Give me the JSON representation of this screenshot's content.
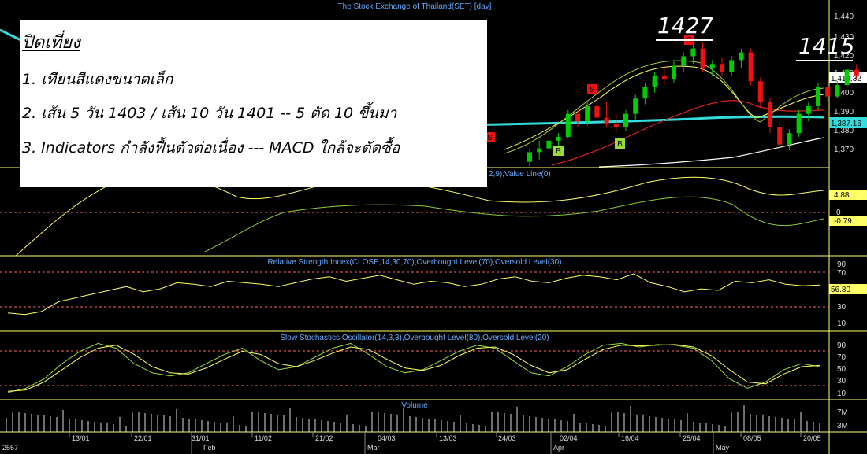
{
  "main_title": "The Stock Exchange of Thailand(SET) [day]",
  "macd_title": "2,9),Value Line(0)",
  "rsi_title": "Relative Strength Index(CLOSE,14,30,70),Overbought Level(70),Oversold Level(30)",
  "stoch_title": "Slow Stochastics Oscillator(14,3,3),Overbought Level(80),Oversold Level(20)",
  "volume_title": "Volume",
  "note": {
    "title": "ปิดเที่ยง",
    "lines": [
      "1. เทียนสีแดงขนาดเล็ก",
      "2. เส้น 5 วัน 1403 / เส้น 10 วัน 1401 -- 5 ตัด 10 ขึ้นมา",
      "3. Indicators กำลังฟื้นตัวต่อเนื่อง --- MACD ใกล้จะตัดซื้อ"
    ]
  },
  "annotations": {
    "high1": "1427",
    "high2": "1415"
  },
  "price_axis": [
    "1,440",
    "1,430",
    "1,420",
    "1,410",
    "1,400",
    "1,390",
    "1,380",
    "1,370"
  ],
  "price_tags": {
    "last": "1,410.32",
    "ma": "1,387.16"
  },
  "macd_axis": {
    "zero": "0",
    "val1": "4.88",
    "val2": "-0.79"
  },
  "rsi_axis": [
    "90",
    "70",
    "50",
    "30",
    "10"
  ],
  "rsi_tag": "56.80",
  "stoch_axis": [
    "90",
    "70",
    "50",
    "30",
    "10"
  ],
  "volume_axis": [
    "7M",
    "3M"
  ],
  "x_dates": [
    "13/01",
    "22/01",
    "31/01",
    "11/02",
    "21/02",
    "04/03",
    "13/03",
    "24/03",
    "02/04",
    "16/04",
    "25/04",
    "08/05",
    "20/05"
  ],
  "x_months": [
    "2557",
    "Feb",
    "Mar",
    "Apr",
    "May"
  ],
  "signals": [
    "S",
    "S",
    "S",
    "B",
    "B"
  ],
  "colors": {
    "bull": "#00cc00",
    "bear": "#ee1111",
    "ma_long": "#33dddd",
    "panel_line": "#ffff66",
    "grid": "#ff6666",
    "axis_text": "#dddddd",
    "title_text": "#66aaff"
  },
  "chart_data": [
    {
      "type": "candlestick",
      "title": "The Stock Exchange of Thailand(SET) [day]",
      "visible_candles": [
        {
          "o": 1365,
          "h": 1372,
          "l": 1362,
          "c": 1370
        },
        {
          "o": 1370,
          "h": 1376,
          "l": 1366,
          "c": 1372
        },
        {
          "o": 1372,
          "h": 1378,
          "l": 1369,
          "c": 1376
        },
        {
          "o": 1376,
          "h": 1380,
          "l": 1373,
          "c": 1378
        },
        {
          "o": 1378,
          "h": 1392,
          "l": 1377,
          "c": 1390
        },
        {
          "o": 1390,
          "h": 1392,
          "l": 1383,
          "c": 1386
        },
        {
          "o": 1386,
          "h": 1396,
          "l": 1384,
          "c": 1394
        },
        {
          "o": 1394,
          "h": 1398,
          "l": 1386,
          "c": 1388
        },
        {
          "o": 1388,
          "h": 1396,
          "l": 1383,
          "c": 1385
        },
        {
          "o": 1385,
          "h": 1390,
          "l": 1380,
          "c": 1383
        },
        {
          "o": 1383,
          "h": 1392,
          "l": 1381,
          "c": 1390
        },
        {
          "o": 1390,
          "h": 1400,
          "l": 1387,
          "c": 1398
        },
        {
          "o": 1398,
          "h": 1406,
          "l": 1395,
          "c": 1404
        },
        {
          "o": 1404,
          "h": 1412,
          "l": 1401,
          "c": 1410
        },
        {
          "o": 1410,
          "h": 1415,
          "l": 1405,
          "c": 1408
        },
        {
          "o": 1408,
          "h": 1418,
          "l": 1406,
          "c": 1415
        },
        {
          "o": 1415,
          "h": 1422,
          "l": 1412,
          "c": 1420
        },
        {
          "o": 1420,
          "h": 1426,
          "l": 1416,
          "c": 1424
        },
        {
          "o": 1424,
          "h": 1427,
          "l": 1412,
          "c": 1414
        },
        {
          "o": 1414,
          "h": 1418,
          "l": 1410,
          "c": 1416
        },
        {
          "o": 1416,
          "h": 1419,
          "l": 1410,
          "c": 1412
        },
        {
          "o": 1412,
          "h": 1420,
          "l": 1410,
          "c": 1418
        },
        {
          "o": 1418,
          "h": 1424,
          "l": 1414,
          "c": 1422
        },
        {
          "o": 1422,
          "h": 1424,
          "l": 1405,
          "c": 1407
        },
        {
          "o": 1407,
          "h": 1409,
          "l": 1393,
          "c": 1396
        },
        {
          "o": 1396,
          "h": 1398,
          "l": 1380,
          "c": 1383
        },
        {
          "o": 1383,
          "h": 1386,
          "l": 1370,
          "c": 1374
        },
        {
          "o": 1374,
          "h": 1382,
          "l": 1371,
          "c": 1380
        },
        {
          "o": 1380,
          "h": 1392,
          "l": 1378,
          "c": 1390
        },
        {
          "o": 1390,
          "h": 1396,
          "l": 1386,
          "c": 1394
        },
        {
          "o": 1394,
          "h": 1406,
          "l": 1392,
          "c": 1404
        },
        {
          "o": 1404,
          "h": 1408,
          "l": 1396,
          "c": 1399
        },
        {
          "o": 1399,
          "h": 1407,
          "l": 1398,
          "c": 1405
        },
        {
          "o": 1405,
          "h": 1415,
          "l": 1403,
          "c": 1413
        },
        {
          "o": 1413,
          "h": 1416,
          "l": 1408,
          "c": 1410
        }
      ],
      "last_close": 1410.32,
      "ma_value": 1387.16
    },
    {
      "type": "line",
      "title": "Relative Strength Index(CLOSE,14,30,70),Overbought Level(70),Oversold Level(30)",
      "ylim": [
        0,
        100
      ],
      "series": [
        {
          "values": [
            20,
            18,
            22,
            35,
            40,
            45,
            50,
            55,
            48,
            52,
            60,
            58,
            55,
            62,
            60,
            58,
            55,
            60,
            65,
            68,
            62,
            66,
            70,
            64,
            58,
            62,
            60,
            55,
            58,
            65,
            68,
            62,
            60,
            66,
            70,
            68,
            64,
            72,
            60,
            55,
            48,
            52,
            50,
            62,
            60,
            64,
            58,
            56,
            57
          ]
        }
      ]
    },
    {
      "type": "line",
      "title": "Slow Stochastics Oscillator(14,3,3),Overbought Level(80),Oversold Level(20)",
      "ylim": [
        0,
        100
      ],
      "series": [
        {
          "values": [
            8,
            15,
            30,
            55,
            75,
            88,
            80,
            55,
            40,
            35,
            40,
            55,
            70,
            80,
            60,
            45,
            50,
            65,
            80,
            88,
            70,
            50,
            40,
            45,
            60,
            75,
            85,
            80,
            60,
            40,
            35,
            50,
            70,
            85,
            88,
            82,
            86,
            85,
            80,
            60,
            30,
            15,
            25,
            45,
            55,
            50
          ]
        },
        {
          "values": [
            10,
            12,
            25,
            45,
            65,
            80,
            85,
            70,
            50,
            40,
            38,
            48,
            62,
            75,
            70,
            55,
            50,
            60,
            72,
            82,
            78,
            62,
            48,
            44,
            52,
            68,
            80,
            82,
            70,
            52,
            40,
            45,
            62,
            78,
            85,
            84,
            85,
            86,
            82,
            68,
            45,
            25,
            22,
            38,
            50,
            52
          ]
        }
      ]
    }
  ]
}
